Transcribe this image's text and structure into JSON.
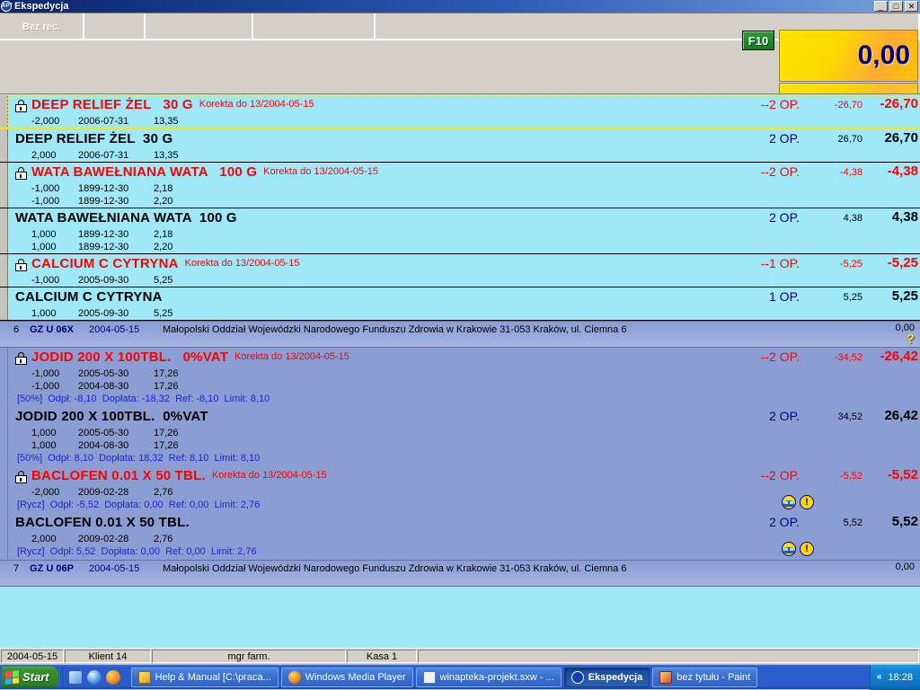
{
  "window": {
    "title": "Ekspedycja",
    "app_icon": "apt-logo-icon",
    "minimize": "_",
    "maximize": "□",
    "close": "✕"
  },
  "toolbar": {
    "tabs": [
      {
        "label": "Bez rec."
      },
      {
        "label": ""
      },
      {
        "label": ""
      },
      {
        "label": ""
      },
      {
        "label": ""
      }
    ],
    "f10_label": "F10",
    "amount": "0,00"
  },
  "rows": [
    {
      "kind": "item",
      "selected": true,
      "locked": true,
      "korekta": true,
      "name": "DEEP RELIEF ŻEL   30 G",
      "note": "Korekta do 13/2004-05-15",
      "sublines": [
        {
          "qty": "-2,000",
          "date": "2006-07-31",
          "price": "13,35"
        }
      ],
      "ref": "",
      "op": "--2 OP.",
      "unit_price": "-26,70",
      "total": "-26,70",
      "badges": [],
      "theme": "cyan"
    },
    {
      "kind": "item",
      "selected": false,
      "locked": false,
      "korekta": false,
      "name": "DEEP RELIEF ŻEL  30 G",
      "note": "",
      "sublines": [
        {
          "qty": "2,000",
          "date": "2006-07-31",
          "price": "13,35"
        }
      ],
      "ref": "",
      "op": "2 OP.",
      "unit_price": "26,70",
      "total": "26,70",
      "badges": [],
      "theme": "cyan"
    },
    {
      "kind": "item",
      "selected": false,
      "locked": true,
      "korekta": true,
      "name": "WATA BAWEŁNIANA WATA   100 G",
      "note": "Korekta do 13/2004-05-15",
      "sublines": [
        {
          "qty": "-1,000",
          "date": "1899-12-30",
          "price": "2,18"
        },
        {
          "qty": "-1,000",
          "date": "1899-12-30",
          "price": "2,20"
        }
      ],
      "ref": "",
      "op": "--2 OP.",
      "unit_price": "-4,38",
      "total": "-4,38",
      "badges": [],
      "theme": "cyan"
    },
    {
      "kind": "item",
      "selected": false,
      "locked": false,
      "korekta": false,
      "name": "WATA BAWEŁNIANA WATA  100 G",
      "note": "",
      "sublines": [
        {
          "qty": "1,000",
          "date": "1899-12-30",
          "price": "2,18"
        },
        {
          "qty": "1,000",
          "date": "1899-12-30",
          "price": "2,20"
        }
      ],
      "ref": "",
      "op": "2 OP.",
      "unit_price": "4,38",
      "total": "4,38",
      "badges": [],
      "theme": "cyan"
    },
    {
      "kind": "item",
      "selected": false,
      "locked": true,
      "korekta": true,
      "name": "CALCIUM C CYTRYNA",
      "note": "Korekta do 13/2004-05-15",
      "sublines": [
        {
          "qty": "-1,000",
          "date": "2005-09-30",
          "price": "5,25"
        }
      ],
      "ref": "",
      "op": "--1 OP.",
      "unit_price": "-5,25",
      "total": "-5,25",
      "badges": [],
      "theme": "cyan"
    },
    {
      "kind": "item",
      "selected": false,
      "locked": false,
      "korekta": false,
      "name": "CALCIUM C CYTRYNA",
      "note": "",
      "sublines": [
        {
          "qty": "1,000",
          "date": "2005-09-30",
          "price": "5,25"
        }
      ],
      "ref": "",
      "op": "1 OP.",
      "unit_price": "5,25",
      "total": "5,25",
      "badges": [],
      "theme": "cyan"
    },
    {
      "kind": "group",
      "num": "6",
      "code": "GZ U 06X",
      "date": "2004-05-15",
      "text": "Małopolski Oddział Wojewódzki Narodowego Funduszu Zdrowia  w Krakowie 31-053 Kraków, ul. Ciemna 6",
      "amount": "0,00",
      "help_icon": "question-mark-icon"
    },
    {
      "kind": "item",
      "selected": false,
      "locked": true,
      "korekta": true,
      "name": "JODID 200 X 100TBL.   0%VAT",
      "note": "Korekta do 13/2004-05-15",
      "sublines": [
        {
          "qty": "-1,000",
          "date": "2005-05-30",
          "price": "17,26"
        },
        {
          "qty": "-1,000",
          "date": "2004-08-30",
          "price": "17,26"
        }
      ],
      "ref": "[50%]  Odpł: -8,10  Dopłata: -18,32  Ref: -8,10  Limit: 8,10",
      "op": "--2 OP.",
      "unit_price": "-34,52",
      "total": "-26,42",
      "badges": [],
      "theme": "blue"
    },
    {
      "kind": "item",
      "selected": false,
      "locked": false,
      "korekta": false,
      "name": "JODID 200 X 100TBL.  0%VAT",
      "note": "",
      "sublines": [
        {
          "qty": "1,000",
          "date": "2005-05-30",
          "price": "17,26"
        },
        {
          "qty": "1,000",
          "date": "2004-08-30",
          "price": "17,26"
        }
      ],
      "ref": "[50%]  Odpł: 8,10  Dopłata: 18,32  Ref: 8,10  Limit: 8,10",
      "op": "2 OP.",
      "unit_price": "34,52",
      "total": "26,42",
      "badges": [],
      "theme": "blue"
    },
    {
      "kind": "item",
      "selected": false,
      "locked": true,
      "korekta": true,
      "name": "BACLOFEN 0.01 X 50 TBL.",
      "note": "Korekta do 13/2004-05-15",
      "sublines": [
        {
          "qty": "-2,000",
          "date": "2009-02-28",
          "price": "2,76"
        }
      ],
      "ref": "[Rycz]  Odpł: -5,52  Dopłata: 0,00  Ref: 0,00  Limit: 2,76",
      "op": "--2 OP.",
      "unit_price": "-5,52",
      "total": "-5,52",
      "badges": [
        "car-icon",
        "exclamation-icon"
      ],
      "theme": "blue"
    },
    {
      "kind": "item",
      "selected": false,
      "locked": false,
      "korekta": false,
      "name": "BACLOFEN 0.01 X 50 TBL.",
      "note": "",
      "sublines": [
        {
          "qty": "2,000",
          "date": "2009-02-28",
          "price": "2,76"
        }
      ],
      "ref": "[Rycz]  Odpł: 5,52  Dopłata: 0,00  Ref: 0,00  Limit: 2,76",
      "op": "2 OP.",
      "unit_price": "5,52",
      "total": "5,52",
      "badges": [
        "car-icon",
        "exclamation-icon"
      ],
      "theme": "blue"
    },
    {
      "kind": "group",
      "num": "7",
      "code": "GZ U 06P",
      "date": "2004-05-15",
      "text": "Małopolski Oddział Wojewódzki Narodowego Funduszu Zdrowia  w Krakowie 31-053 Kraków, ul. Ciemna 6",
      "amount": "0,00",
      "help_icon": ""
    }
  ],
  "statusbar": {
    "date": "2004-05-15",
    "client": "Klient 14",
    "user": "mgr farm.",
    "register": "Kasa 1",
    "extra": ""
  },
  "taskbar": {
    "start_label": "Start",
    "quicklaunch": [
      {
        "name": "show-desktop-icon"
      },
      {
        "name": "internet-explorer-icon"
      },
      {
        "name": "media-player-icon"
      }
    ],
    "tasks": [
      {
        "label": "Help & Manual [C:\\praca...",
        "icon": "help-manual-icon",
        "active": false
      },
      {
        "label": "Windows Media Player",
        "icon": "media-player-icon",
        "active": false
      },
      {
        "label": "winapteka-projekt.sxw - ...",
        "icon": "writer-doc-icon",
        "active": false
      },
      {
        "label": "Ekspedycja",
        "icon": "apt-logo-icon",
        "active": true
      },
      {
        "label": "bez tytułu - Paint",
        "icon": "paint-icon",
        "active": false
      }
    ],
    "tray_chevron": "«",
    "clock": "18:28"
  },
  "colors": {
    "cyan_row": "#9fe8f7",
    "blue_row": "#8b9ed4",
    "korekta_red": "#ff0000",
    "accent_navy": "#00007f",
    "selection_yellow": "#ffe600",
    "amount_yellow": "#ffd800",
    "f10_green": "#2e9a3e"
  }
}
